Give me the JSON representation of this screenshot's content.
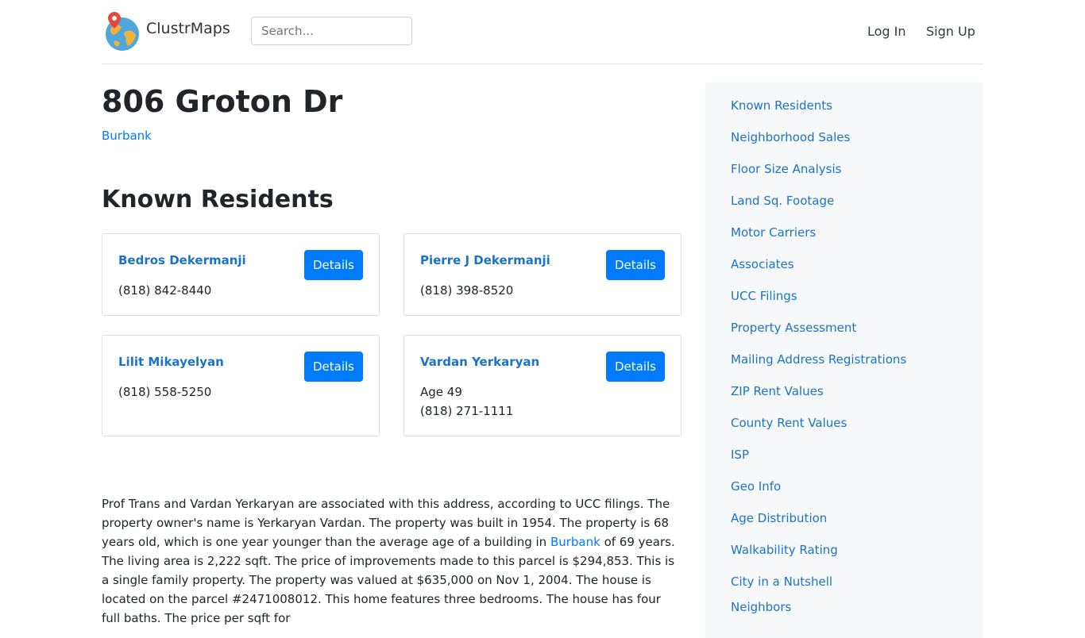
{
  "header": {
    "brand": "ClustrMaps",
    "search_placeholder": "Search...",
    "login": "Log In",
    "signup": "Sign Up"
  },
  "page": {
    "title": "806 Groton Dr",
    "city": "Burbank",
    "residents_heading": "Known Residents"
  },
  "residents": [
    {
      "name": "Bedros Dekermanji",
      "details": "Details",
      "line1": "(818) 842-8440"
    },
    {
      "name": "Pierre J Dekermanji",
      "details": "Details",
      "line1": "(818) 398-8520"
    },
    {
      "name": "Lilit Mikayelyan",
      "details": "Details",
      "line1": "(818) 558-5250"
    },
    {
      "name": "Vardan Yerkaryan",
      "details": "Details",
      "line1": "Age 49",
      "line2": "(818) 271-1111"
    }
  ],
  "description": {
    "before_link": "Prof Trans and Vardan Yerkaryan are associated with this address, according to UCC filings. The property owner's name is Yerkaryan Vardan. The property was built in 1954. The property is 68 years old, which is one year younger than the average age of a building in ",
    "link": "Burbank",
    "after_link": " of 69 years. The living area is 2,222 sqft. The price of improvements made to this parcel is $294,853. This is a single family property. The property was valued at $635,000 on Nov 1, 2004. The house is located on the parcel #2471008012. This home features three bedrooms. The house has four full baths. The price per sqft for"
  },
  "sidebar": {
    "items": [
      "Known Residents",
      "Neighborhood Sales",
      "Floor Size Analysis",
      "Land Sq. Footage",
      "Motor Carriers",
      "Associates",
      "UCC Filings",
      "Property Assessment",
      "Mailing Address Registrations",
      "ZIP Rent Values",
      "County Rent Values",
      "ISP",
      "Geo Info",
      "Age Distribution",
      "Walkability Rating",
      "City in a Nutshell",
      "Neighbors"
    ]
  },
  "colors": {
    "primary_button": "#007bff",
    "link": "#1a73c8",
    "sidebar_bg": "#f7f8f9"
  },
  "icons": {
    "logo": "globe-with-map-pin-icon"
  }
}
